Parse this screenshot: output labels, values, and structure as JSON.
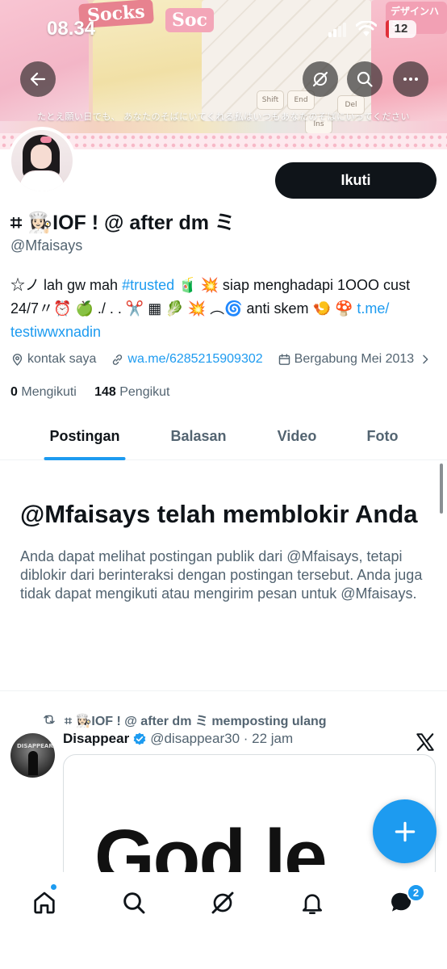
{
  "status_bar": {
    "time": "08.34",
    "battery": "12"
  },
  "banner": {
    "label_left": "Socks",
    "label_mid": "Soc",
    "label_right": "デザインハミ",
    "caption": "たとえ願い日でも、 あなたのそばにいてくれる私はいつもあなたのそばにいってください",
    "keys": [
      "Shift",
      "End",
      "Ins",
      "Del"
    ]
  },
  "profile": {
    "follow_label": "Ikuti",
    "display_name": "⌗ 👩🏻‍🍳IOF ! @ after dm ミ",
    "handle": "@Mfaisays",
    "bio_part1": "☆ノ lah gw mah ",
    "bio_hashtag": "#trusted",
    "bio_part2": " 🧃 💥 siap menghadapi 1OOO cust 24/7〃⏰ 🍏 ./ . . ✂️ ▦ 🥬 💥 ︵🌀 anti skem 🍤 🍄 ",
    "bio_link": "t.me/ testiwwxnadin",
    "location": "kontak saya",
    "website": "wa.me/6285215909302",
    "joined": "Bergabung Mei 2013",
    "following_count": "0",
    "following_label": "Mengikuti",
    "followers_count": "148",
    "followers_label": "Pengikut"
  },
  "tabs": [
    {
      "label": "Postingan",
      "active": true
    },
    {
      "label": "Balasan",
      "active": false
    },
    {
      "label": "Video",
      "active": false
    },
    {
      "label": "Foto",
      "active": false
    }
  ],
  "blocked_notice": {
    "title": "@Mfaisays telah memblokir Anda",
    "body": "Anda dapat melihat postingan publik dari @Mfaisays, tetapi diblokir dari berinteraksi dengan postingan tersebut. Anda juga tidak dapat mengikuti atau mengirim pesan untuk @Mfaisays."
  },
  "post": {
    "repost_text": "⌗ 👩🏻‍🍳IOF ! @ after dm ミ memposting ulang",
    "author_name": "Disappear",
    "author_meta": "@disappear30 · 22 jam",
    "avatar_text": "DISAPPEAR",
    "media_text": "God  le"
  },
  "bottom_nav": {
    "messages_badge": "2"
  },
  "colors": {
    "accent": "#1d9bf0",
    "text": "#0f1419",
    "secondary": "#536471"
  }
}
